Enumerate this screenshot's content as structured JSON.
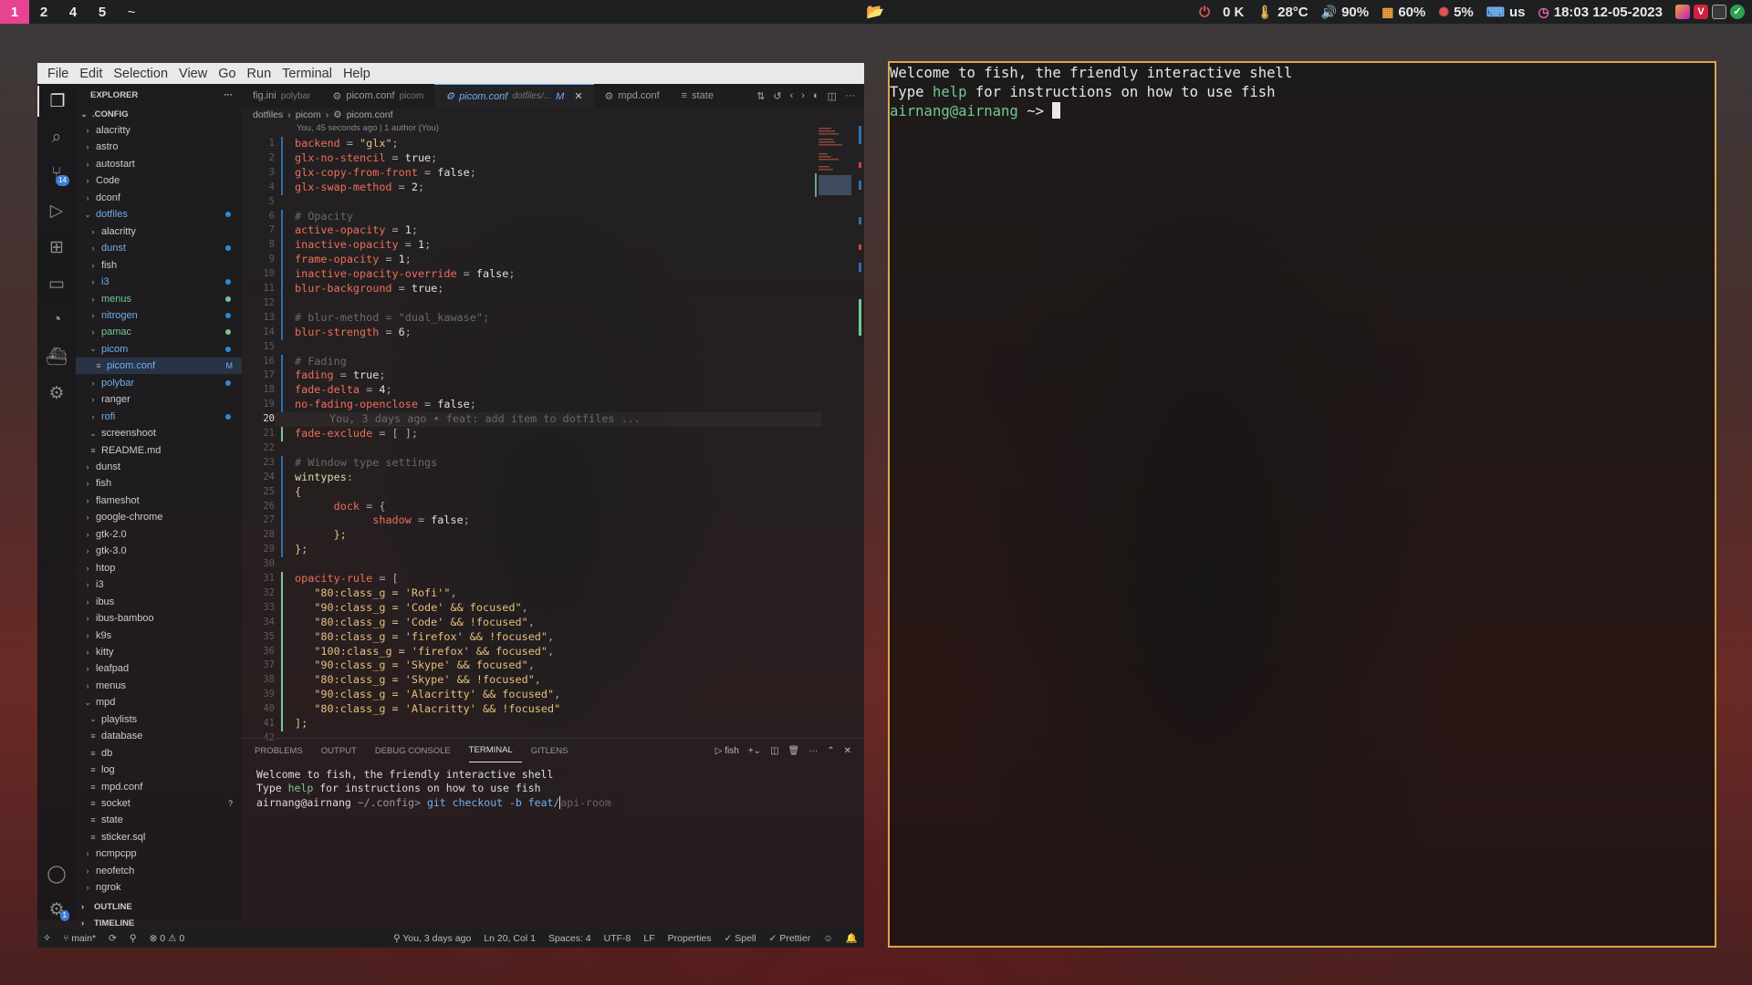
{
  "topbar": {
    "workspaces": [
      "1",
      "2",
      "4",
      "5",
      "~"
    ],
    "active_workspace": "1",
    "power_icon": "power-icon",
    "net": "0 K",
    "temp": "28°C",
    "volume": "90%",
    "memory": "60%",
    "cpu": "5%",
    "keyboard": "us",
    "clock": "18:03  12-05-2023"
  },
  "vscode": {
    "menu": [
      "File",
      "Edit",
      "Selection",
      "View",
      "Go",
      "Run",
      "Terminal",
      "Help"
    ],
    "explorer_title": "EXPLORER",
    "root_folder": ".CONFIG",
    "tree": [
      {
        "label": "alacritty",
        "depth": 0,
        "type": "folder"
      },
      {
        "label": "astro",
        "depth": 0,
        "type": "folder"
      },
      {
        "label": "autostart",
        "depth": 0,
        "type": "folder"
      },
      {
        "label": "Code",
        "depth": 0,
        "type": "folder"
      },
      {
        "label": "dconf",
        "depth": 0,
        "type": "folder"
      },
      {
        "label": "dotfiles",
        "depth": 0,
        "type": "folder-open",
        "color": "blue",
        "dot": "blue"
      },
      {
        "label": "alacritty",
        "depth": 1,
        "type": "folder"
      },
      {
        "label": "dunst",
        "depth": 1,
        "type": "folder",
        "color": "blue",
        "dot": "blue"
      },
      {
        "label": "fish",
        "depth": 1,
        "type": "folder"
      },
      {
        "label": "i3",
        "depth": 1,
        "type": "folder",
        "color": "blue",
        "dot": "blue"
      },
      {
        "label": "menus",
        "depth": 1,
        "type": "folder",
        "color": "green",
        "dot": "green"
      },
      {
        "label": "nitrogen",
        "depth": 1,
        "type": "folder",
        "color": "blue",
        "dot": "blue"
      },
      {
        "label": "pamac",
        "depth": 1,
        "type": "folder",
        "color": "green",
        "dot": "green"
      },
      {
        "label": "picom",
        "depth": 1,
        "type": "folder-open",
        "color": "blue",
        "dot": "blue"
      },
      {
        "label": "picom.conf",
        "depth": 2,
        "type": "file",
        "color": "blue",
        "mark": "M",
        "selected": true
      },
      {
        "label": "polybar",
        "depth": 1,
        "type": "folder",
        "color": "blue",
        "dot": "blue"
      },
      {
        "label": "ranger",
        "depth": 1,
        "type": "folder"
      },
      {
        "label": "rofi",
        "depth": 1,
        "type": "folder",
        "color": "blue",
        "dot": "blue"
      },
      {
        "label": "screenshoot",
        "depth": 1,
        "type": "folder-open"
      },
      {
        "label": "README.md",
        "depth": 1,
        "type": "file"
      },
      {
        "label": "dunst",
        "depth": 0,
        "type": "folder"
      },
      {
        "label": "fish",
        "depth": 0,
        "type": "folder"
      },
      {
        "label": "flameshot",
        "depth": 0,
        "type": "folder"
      },
      {
        "label": "google-chrome",
        "depth": 0,
        "type": "folder"
      },
      {
        "label": "gtk-2.0",
        "depth": 0,
        "type": "folder"
      },
      {
        "label": "gtk-3.0",
        "depth": 0,
        "type": "folder"
      },
      {
        "label": "htop",
        "depth": 0,
        "type": "folder"
      },
      {
        "label": "i3",
        "depth": 0,
        "type": "folder"
      },
      {
        "label": "ibus",
        "depth": 0,
        "type": "folder"
      },
      {
        "label": "ibus-bamboo",
        "depth": 0,
        "type": "folder"
      },
      {
        "label": "k9s",
        "depth": 0,
        "type": "folder"
      },
      {
        "label": "kitty",
        "depth": 0,
        "type": "folder"
      },
      {
        "label": "leafpad",
        "depth": 0,
        "type": "folder"
      },
      {
        "label": "menus",
        "depth": 0,
        "type": "folder"
      },
      {
        "label": "mpd",
        "depth": 0,
        "type": "folder-open"
      },
      {
        "label": "playlists",
        "depth": 1,
        "type": "folder-open"
      },
      {
        "label": "database",
        "depth": 1,
        "type": "file"
      },
      {
        "label": "db",
        "depth": 1,
        "type": "file"
      },
      {
        "label": "log",
        "depth": 1,
        "type": "file"
      },
      {
        "label": "mpd.conf",
        "depth": 1,
        "type": "file"
      },
      {
        "label": "socket",
        "depth": 1,
        "type": "file",
        "mark": "?"
      },
      {
        "label": "state",
        "depth": 1,
        "type": "file"
      },
      {
        "label": "sticker.sql",
        "depth": 1,
        "type": "file"
      },
      {
        "label": "ncmpcpp",
        "depth": 0,
        "type": "folder"
      },
      {
        "label": "neofetch",
        "depth": 0,
        "type": "folder"
      },
      {
        "label": "ngrok",
        "depth": 0,
        "type": "folder"
      }
    ],
    "outline": "OUTLINE",
    "timeline": "TIMELINE",
    "tabs": [
      {
        "label": "fig.ini",
        "desc": "polybar"
      },
      {
        "label": "picom.conf",
        "desc": "picom"
      },
      {
        "label": "picom.conf",
        "desc": "dotfiles/...",
        "mark": "M",
        "active": true
      },
      {
        "label": "mpd.conf",
        "desc": ""
      },
      {
        "label": "state",
        "desc": ""
      }
    ],
    "breadcrumb": [
      "dotfiles",
      "picom",
      "picom.conf"
    ],
    "blame_header": "You, 45 seconds ago | 1 author (You)",
    "inline_blame": "You, 3 days ago • feat: add item to dotfiles ...",
    "current_line": 20,
    "code": [
      [
        [
          "k",
          "backend"
        ],
        [
          "p",
          " = "
        ],
        [
          "s",
          "\"glx\""
        ],
        [
          "p",
          ";"
        ]
      ],
      [
        [
          "k",
          "glx-no-stencil"
        ],
        [
          "p",
          " = "
        ],
        [
          "n",
          "true"
        ],
        [
          "p",
          ";"
        ]
      ],
      [
        [
          "k",
          "glx-copy-from-front"
        ],
        [
          "p",
          " = "
        ],
        [
          "n",
          "false"
        ],
        [
          "p",
          ";"
        ]
      ],
      [
        [
          "k",
          "glx-swap-method"
        ],
        [
          "p",
          " = "
        ],
        [
          "n",
          "2"
        ],
        [
          "p",
          ";"
        ]
      ],
      [],
      [
        [
          "c",
          "# Opacity"
        ]
      ],
      [
        [
          "k",
          "active-opacity"
        ],
        [
          "p",
          " = "
        ],
        [
          "n",
          "1"
        ],
        [
          "p",
          ";"
        ]
      ],
      [
        [
          "k",
          "inactive-opacity"
        ],
        [
          "p",
          " = "
        ],
        [
          "n",
          "1"
        ],
        [
          "p",
          ";"
        ]
      ],
      [
        [
          "k",
          "frame-opacity"
        ],
        [
          "p",
          " = "
        ],
        [
          "n",
          "1"
        ],
        [
          "p",
          ";"
        ]
      ],
      [
        [
          "k",
          "inactive-opacity-override"
        ],
        [
          "p",
          " = "
        ],
        [
          "n",
          "false"
        ],
        [
          "p",
          ";"
        ]
      ],
      [
        [
          "k",
          "blur-background"
        ],
        [
          "p",
          " = "
        ],
        [
          "n",
          "true"
        ],
        [
          "p",
          ";"
        ]
      ],
      [],
      [
        [
          "c",
          "# blur-method = \"dual_kawase\";"
        ]
      ],
      [
        [
          "k",
          "blur-strength"
        ],
        [
          "p",
          " = "
        ],
        [
          "n",
          "6"
        ],
        [
          "p",
          ";"
        ]
      ],
      [],
      [
        [
          "c",
          "# Fading"
        ]
      ],
      [
        [
          "k",
          "fading"
        ],
        [
          "p",
          " = "
        ],
        [
          "n",
          "true"
        ],
        [
          "p",
          ";"
        ]
      ],
      [
        [
          "k",
          "fade-delta"
        ],
        [
          "p",
          " = "
        ],
        [
          "n",
          "4"
        ],
        [
          "p",
          ";"
        ]
      ],
      [
        [
          "k",
          "no-fading-openclose"
        ],
        [
          "p",
          " = "
        ],
        [
          "n",
          "false"
        ],
        [
          "p",
          ";"
        ]
      ],
      [],
      [
        [
          "k",
          "fade-exclude"
        ],
        [
          "p",
          " = [ ];"
        ]
      ],
      [],
      [
        [
          "c",
          "# Window type settings"
        ]
      ],
      [
        [
          "t",
          "wintypes"
        ],
        [
          "p",
          ":"
        ]
      ],
      [
        [
          "s",
          "{"
        ]
      ],
      [
        [
          "p",
          "      "
        ],
        [
          "k",
          "dock"
        ],
        [
          "p",
          " = {"
        ]
      ],
      [
        [
          "p",
          "            "
        ],
        [
          "k",
          "shadow"
        ],
        [
          "p",
          " = "
        ],
        [
          "n",
          "false"
        ],
        [
          "p",
          ";"
        ]
      ],
      [
        [
          "p",
          "      "
        ],
        [
          "s",
          "};"
        ]
      ],
      [
        [
          "s",
          "};"
        ]
      ],
      [],
      [
        [
          "k",
          "opacity-rule"
        ],
        [
          "p",
          " = ["
        ]
      ],
      [
        [
          "p",
          "   "
        ],
        [
          "s",
          "\"80:class_g = 'Rofi'\""
        ],
        [
          "p",
          ","
        ]
      ],
      [
        [
          "p",
          "   "
        ],
        [
          "s",
          "\"90:class_g = 'Code' && focused\""
        ],
        [
          "p",
          ","
        ]
      ],
      [
        [
          "p",
          "   "
        ],
        [
          "s",
          "\"80:class_g = 'Code' && !focused\""
        ],
        [
          "p",
          ","
        ]
      ],
      [
        [
          "p",
          "   "
        ],
        [
          "s",
          "\"80:class_g = 'firefox' && !focused\""
        ],
        [
          "p",
          ","
        ]
      ],
      [
        [
          "p",
          "   "
        ],
        [
          "s",
          "\"100:class_g = 'firefox' && focused\""
        ],
        [
          "p",
          ","
        ]
      ],
      [
        [
          "p",
          "   "
        ],
        [
          "s",
          "\"90:class_g = 'Skype' && focused\""
        ],
        [
          "p",
          ","
        ]
      ],
      [
        [
          "p",
          "   "
        ],
        [
          "s",
          "\"80:class_g = 'Skype' && !focused\""
        ],
        [
          "p",
          ","
        ]
      ],
      [
        [
          "p",
          "   "
        ],
        [
          "s",
          "\"90:class_g = 'Alacritty' && focused\""
        ],
        [
          "p",
          ","
        ]
      ],
      [
        [
          "p",
          "   "
        ],
        [
          "s",
          "\"80:class_g = 'Alacritty' && !focused\""
        ]
      ],
      [
        [
          "s",
          "];"
        ]
      ],
      []
    ],
    "panel_tabs": [
      "PROBLEMS",
      "OUTPUT",
      "DEBUG CONSOLE",
      "TERMINAL",
      "GITLENS"
    ],
    "active_panel_tab": "TERMINAL",
    "panel_shell": "fish",
    "panel_term": {
      "line1": "Welcome to fish, the friendly interactive shell",
      "line2_a": "Type ",
      "line2_help": "help",
      "line2_b": " for instructions on how to use fish",
      "prompt_user": "airnang@airnang",
      "prompt_path": " ~/.config>",
      "command": " git checkout -b feat/",
      "autosuggest": "api-room"
    },
    "status": {
      "branch": "main*",
      "errors": "0",
      "warnings": "0",
      "blame": "You, 3 days ago",
      "position": "Ln 20, Col 1",
      "spaces": "Spaces: 4",
      "encoding": "UTF-8",
      "eol": "LF",
      "language": "Properties",
      "spell": "Spell",
      "prettier": "Prettier"
    }
  },
  "terminal": {
    "line1": "Welcome to fish, the friendly interactive shell",
    "line2_a": "Type ",
    "line2_help": "help",
    "line2_b": " for instructions on how to use fish",
    "prompt_user": "airnang@airnang",
    "prompt_path": " ~> "
  },
  "colors": {
    "accent_pink": "#e8438f",
    "term_border": "#d9a84b",
    "git_green": "#73c991",
    "git_blue": "#6fb0f0"
  }
}
